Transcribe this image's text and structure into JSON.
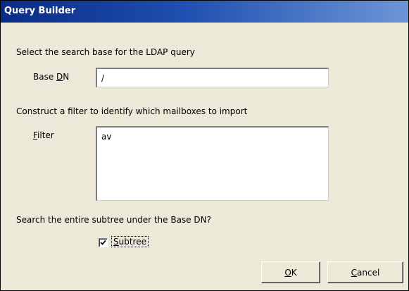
{
  "window": {
    "title": "Query Builder"
  },
  "search_base": {
    "instruction": "Select the search base for the LDAP query",
    "base_dn_label_pre": "Base ",
    "base_dn_label_accel": "D",
    "base_dn_label_post": "N",
    "base_dn_value": "/"
  },
  "filter": {
    "instruction": "Construct a filter to identify which mailboxes to import",
    "label_accel": "F",
    "label_rest": "ilter",
    "value": "av"
  },
  "subtree": {
    "question": "Search the entire subtree under the Base DN?",
    "checkbox_label_accel": "S",
    "checkbox_label_rest": "ubtree",
    "checked": true
  },
  "buttons": {
    "ok_accel": "O",
    "ok_rest": "K",
    "cancel_accel": "C",
    "cancel_rest": "ancel"
  }
}
